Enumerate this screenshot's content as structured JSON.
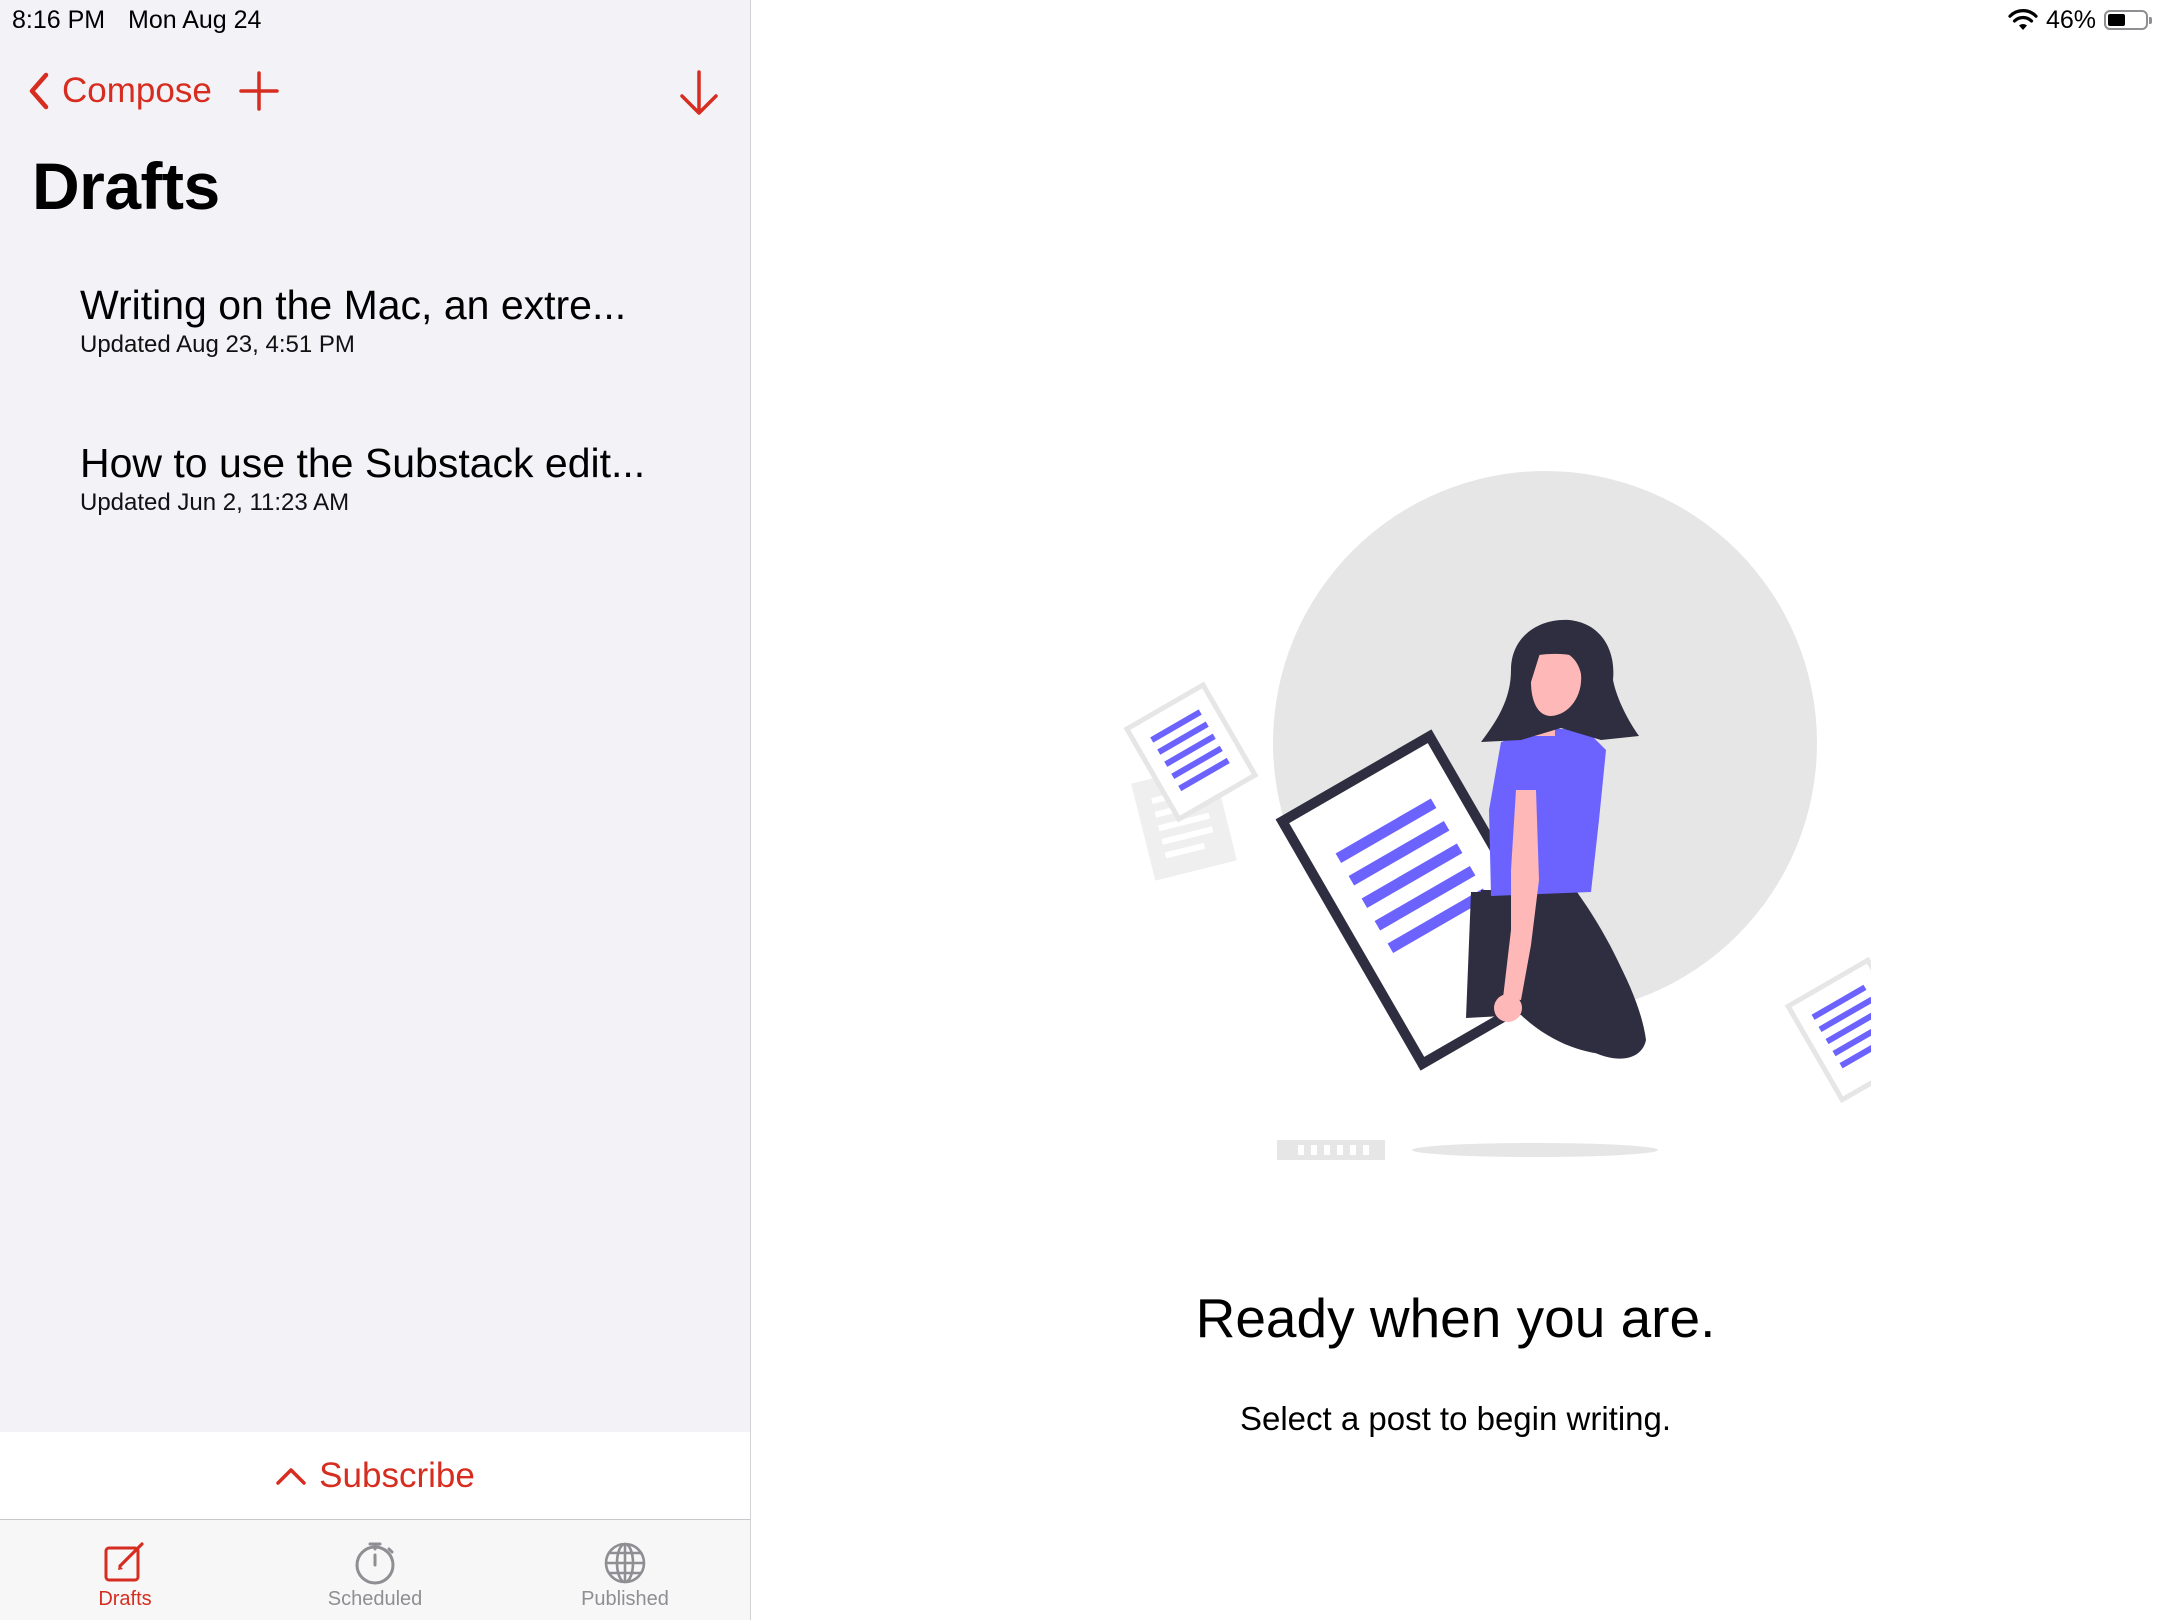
{
  "status_bar": {
    "time": "8:16 PM",
    "date": "Mon Aug 24",
    "battery_percent": "46%",
    "battery_level": 0.46,
    "wifi_icon": "wifi-icon"
  },
  "sidebar": {
    "back_label": "Compose",
    "back_icon": "chevron-left-icon",
    "add_icon": "plus-icon",
    "download_icon": "arrow-down-icon",
    "title": "Drafts",
    "drafts": [
      {
        "title": "Writing on the Mac, an extre...",
        "updated": "Updated Aug 23, 4:51 PM"
      },
      {
        "title": "How to use the Substack edit...",
        "updated": "Updated Jun 2, 11:23 AM"
      }
    ],
    "subscribe_label": "Subscribe",
    "subscribe_icon": "chevron-up-icon"
  },
  "tabs": [
    {
      "label": "Drafts",
      "icon": "compose-icon",
      "active": true
    },
    {
      "label": "Scheduled",
      "icon": "stopwatch-icon",
      "active": false
    },
    {
      "label": "Published",
      "icon": "globe-icon",
      "active": false
    }
  ],
  "main": {
    "heading": "Ready when you are.",
    "subheading": "Select a post to begin writing."
  },
  "colors": {
    "accent": "#d62d20",
    "sidebar_bg": "#f2f2f7",
    "illustration_purple": "#6c63ff",
    "illustration_dark": "#2f2e41",
    "illustration_skin": "#ffb8b8"
  }
}
